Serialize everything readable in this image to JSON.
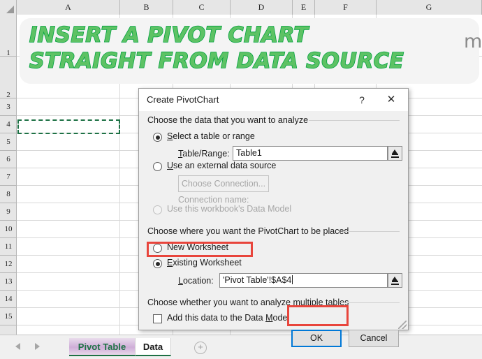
{
  "spreadsheet": {
    "columns": [
      "A",
      "B",
      "C",
      "D",
      "E",
      "F",
      "G"
    ],
    "column_x": [
      24,
      172,
      248,
      330,
      419,
      451,
      539,
      690
    ],
    "rows": [
      "1",
      "2",
      "3",
      "4",
      "5",
      "6",
      "7",
      "8",
      "9",
      "10",
      "11",
      "12",
      "13",
      "14",
      "15"
    ],
    "selected_cell": "A4",
    "banner_text": "INSERT A PIVOT CHART\nSTRAIGHT FROM DATA SOURCE",
    "stray_cell_text": "m",
    "tabs": [
      {
        "label": "Pivot Table",
        "active": false
      },
      {
        "label": "Data",
        "active": true
      }
    ],
    "add_sheet_icon": "plus-circle-icon",
    "nav_prev_icon": "arrow-left-icon",
    "nav_next_icon": "arrow-right-icon"
  },
  "dialog": {
    "title": "Create PivotChart",
    "help_icon": "?",
    "close_icon": "✕",
    "section_analyze": "Choose the data that you want to analyze",
    "opt_select_table": "Select a table or range",
    "opt_select_table_underline": "S",
    "table_range_label": "Table/Range:",
    "table_range_value": "Table1",
    "opt_external": "Use an external data source",
    "opt_external_underline": "U",
    "choose_connection_button": "Choose Connection...",
    "connection_name_label": "Connection name:",
    "opt_data_model": "Use this workbook's Data Model",
    "section_placement": "Choose where you want the PivotChart to be placed",
    "opt_new_worksheet": "New Worksheet",
    "opt_existing_worksheet": "Existing Worksheet",
    "opt_existing_underline": "E",
    "location_label": "Location:",
    "location_value": "'Pivot Table'!$A$4",
    "section_multiple": "Choose whether you want to analyze multiple tables",
    "checkbox_data_model": "Add this data to the Data Model",
    "ok_button": "OK",
    "cancel_button": "Cancel",
    "collapse_icon": "collapse-dialog-icon",
    "selected_data_option": "select_table",
    "selected_placement_option": "existing_worksheet",
    "data_model_checked": false
  },
  "annotations": {
    "highlight_color": "#e8453c",
    "focus_color": "#0078d7",
    "banner_fill": "#5dc264",
    "banner_stroke": "#00a23f",
    "tab_accent": "#1e7145"
  }
}
